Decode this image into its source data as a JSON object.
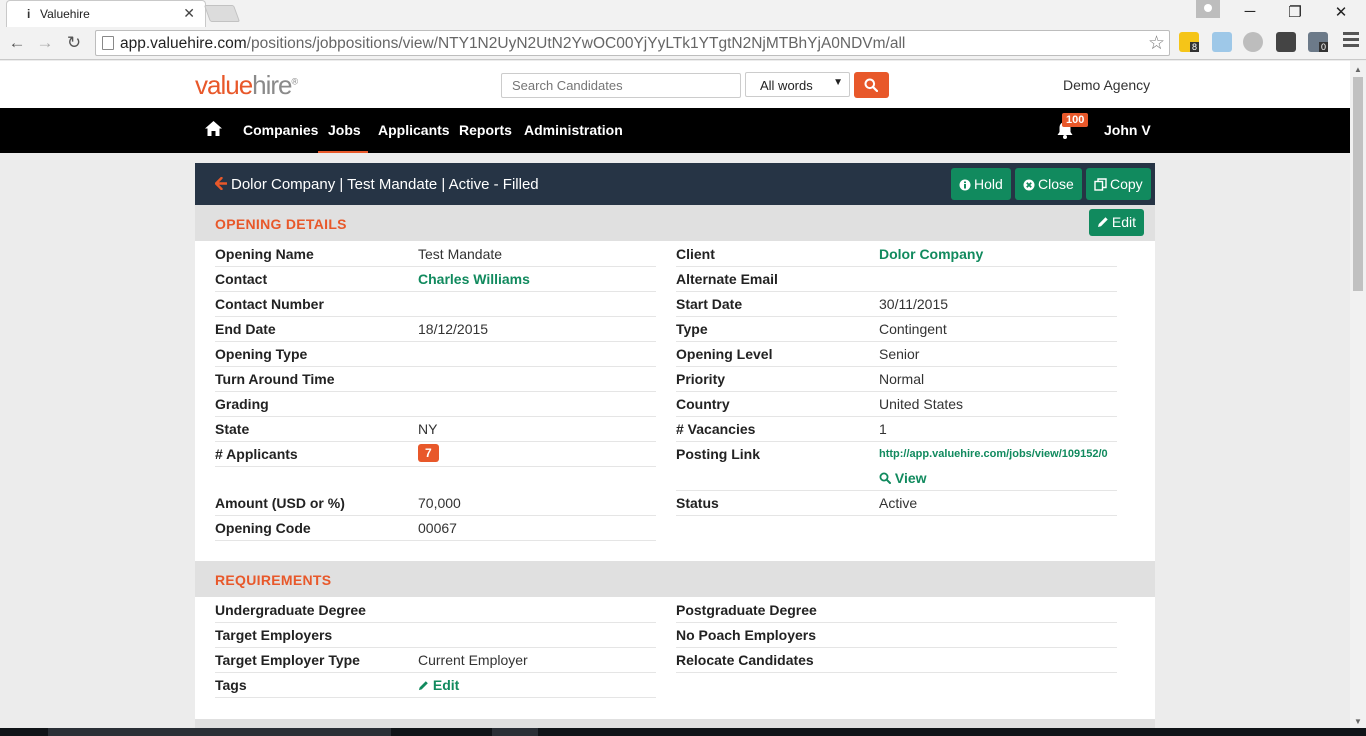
{
  "browser": {
    "tab_title": "Valuehire",
    "url_host": "app.valuehire.com",
    "url_path": "/positions/jobpositions/view/NTY1N2UyN2UtN2YwOC00YjYyLTk1YTgtN2NjMTBhYjA0NDVm/all",
    "ext_badge_1": "8",
    "ext_badge_2": "0"
  },
  "header": {
    "logo_value": "value",
    "logo_hire": "hire",
    "logo_mark": "®",
    "search_placeholder": "Search Candidates",
    "search_mode": "All words",
    "agency": "Demo Agency"
  },
  "nav": {
    "items": [
      "Companies",
      "Jobs",
      "Applicants",
      "Reports",
      "Administration"
    ],
    "active": "Jobs",
    "notification_count": "100",
    "user": "John V"
  },
  "card": {
    "title": "Dolor Company | Test Mandate | Active - Filled",
    "hold_label": "Hold",
    "close_label": "Close",
    "copy_label": "Copy"
  },
  "opening_details": {
    "section_title": "OPENING DETAILS",
    "edit_label": "Edit",
    "left": [
      {
        "label": "Opening Name",
        "value": "Test Mandate"
      },
      {
        "label": "Contact",
        "value": "Charles Williams"
      },
      {
        "label": "Contact Number",
        "value": ""
      },
      {
        "label": "End Date",
        "value": "18/12/2015"
      },
      {
        "label": "Opening Type",
        "value": ""
      },
      {
        "label": "Turn Around Time",
        "value": ""
      },
      {
        "label": "Grading",
        "value": ""
      },
      {
        "label": "State",
        "value": "NY"
      },
      {
        "label": "# Applicants",
        "value": "7"
      },
      {
        "label": "Amount (USD or %)",
        "value": "70,000"
      },
      {
        "label": "Opening Code",
        "value": "00067"
      }
    ],
    "right": [
      {
        "label": "Client",
        "value": "Dolor Company"
      },
      {
        "label": "Alternate Email",
        "value": ""
      },
      {
        "label": "Start Date",
        "value": "30/11/2015"
      },
      {
        "label": "Type",
        "value": "Contingent"
      },
      {
        "label": "Opening Level",
        "value": "Senior"
      },
      {
        "label": "Priority",
        "value": "Normal"
      },
      {
        "label": "Country",
        "value": "United States"
      },
      {
        "label": "# Vacancies",
        "value": "1"
      },
      {
        "label": "Posting Link",
        "value": "http://app.valuehire.com/jobs/view/109152/0"
      },
      {
        "label": "Status",
        "value": "Active"
      }
    ],
    "view_label": "View"
  },
  "requirements": {
    "section_title": "REQUIREMENTS",
    "left": [
      {
        "label": "Undergraduate Degree",
        "value": ""
      },
      {
        "label": "Target Employers",
        "value": ""
      },
      {
        "label": "Target Employer Type",
        "value": "Current Employer"
      },
      {
        "label": "Tags",
        "value": "Edit"
      }
    ],
    "right": [
      {
        "label": "Postgraduate Degree",
        "value": ""
      },
      {
        "label": "No Poach Employers",
        "value": ""
      },
      {
        "label": "Relocate Candidates",
        "value": ""
      }
    ]
  }
}
